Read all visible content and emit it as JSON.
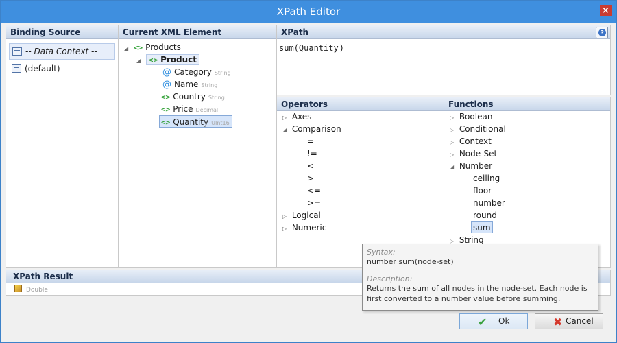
{
  "window": {
    "title": "XPath Editor",
    "close_glyph": "×"
  },
  "binding": {
    "header": "Binding Source",
    "items": [
      {
        "label": "-- Data Context --",
        "icon": "database-icon"
      },
      {
        "label": "(default)",
        "icon": "database-icon"
      }
    ]
  },
  "xml": {
    "header": "Current XML Element",
    "root": {
      "label": "Products"
    },
    "product": {
      "label": "Product"
    },
    "children": [
      {
        "label": "Category",
        "type": "String",
        "kind": "attribute"
      },
      {
        "label": "Name",
        "type": "String",
        "kind": "attribute"
      },
      {
        "label": "Country",
        "type": "String",
        "kind": "element"
      },
      {
        "label": "Price",
        "type": "Decimal",
        "kind": "element"
      },
      {
        "label": "Quantity",
        "type": "UInt16",
        "kind": "element"
      }
    ]
  },
  "xpath": {
    "header": "XPath",
    "expression": "sum(Quantity",
    "expression_tail": ")"
  },
  "operators": {
    "header": "Operators",
    "groups": [
      {
        "label": "Axes"
      },
      {
        "label": "Comparison"
      },
      {
        "label": "Logical"
      },
      {
        "label": "Numeric"
      }
    ],
    "comparison_items": [
      "=",
      "!=",
      "<",
      ">",
      "<=",
      ">="
    ]
  },
  "functions": {
    "header": "Functions",
    "groups": [
      "Boolean",
      "Conditional",
      "Context",
      "Node-Set",
      "Number",
      "String"
    ],
    "number_items": [
      "ceiling",
      "floor",
      "number",
      "round",
      "sum"
    ]
  },
  "tooltip": {
    "syntax_label": "Syntax:",
    "syntax": "number sum(node-set)",
    "description_label": "Description:",
    "description": "Returns the sum of all nodes in the node-set. Each node is first converted to a number value before summing."
  },
  "result": {
    "header": "XPath Result",
    "type": "Double"
  },
  "buttons": {
    "ok": "Ok",
    "cancel": "Cancel"
  },
  "colors": {
    "titlebar": "#3f8fdf",
    "accent": "#3d82c9",
    "element_icon": "#36a33b",
    "attribute_icon": "#2f8fe0"
  }
}
